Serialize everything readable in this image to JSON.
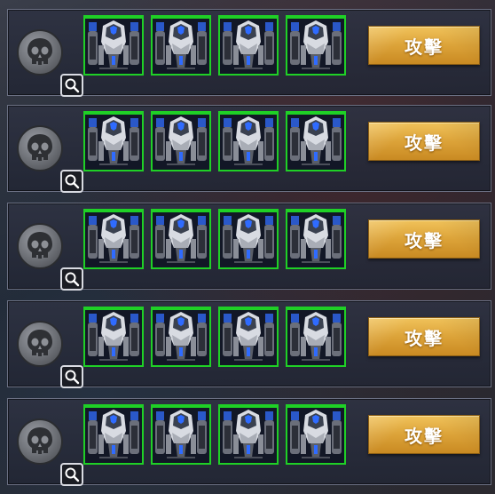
{
  "colors": {
    "unit_border": "#1fd026",
    "attack_button": "#dca339",
    "panel_bg": "#2e3242"
  },
  "rows": [
    {
      "units": [
        "mech-unit",
        "mech-unit",
        "mech-unit",
        "mech-unit"
      ],
      "attack_label": "攻擊"
    },
    {
      "units": [
        "mech-unit",
        "mech-unit",
        "mech-unit",
        "mech-unit"
      ],
      "attack_label": "攻擊"
    },
    {
      "units": [
        "mech-unit",
        "mech-unit",
        "mech-unit",
        "mech-unit"
      ],
      "attack_label": "攻擊"
    },
    {
      "units": [
        "mech-unit",
        "mech-unit",
        "mech-unit",
        "mech-unit"
      ],
      "attack_label": "攻擊"
    },
    {
      "units": [
        "mech-unit",
        "mech-unit",
        "mech-unit",
        "mech-unit"
      ],
      "attack_label": "攻擊"
    }
  ],
  "icons": {
    "emblem": "skull-emblem-icon",
    "search": "magnifier-icon"
  }
}
